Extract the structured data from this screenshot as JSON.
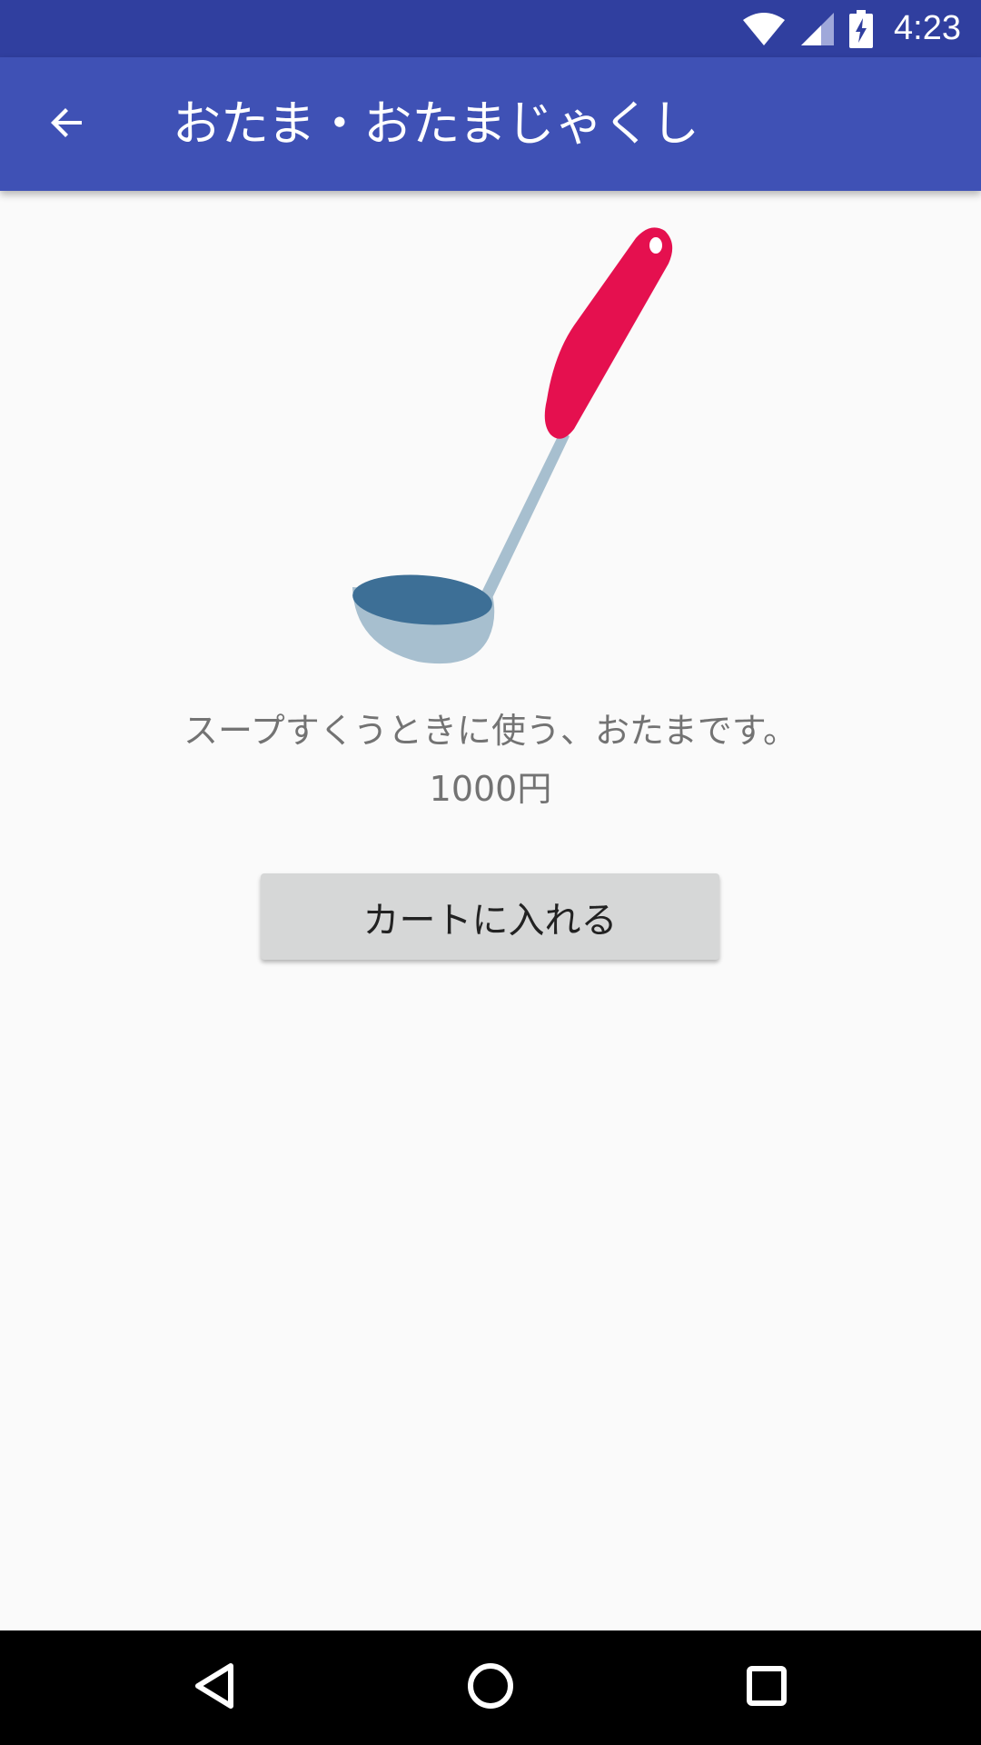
{
  "status_bar": {
    "time": "4:23",
    "icons": [
      "wifi-icon",
      "cell-signal-icon",
      "battery-charging-icon"
    ]
  },
  "app_bar": {
    "back_icon": "arrow-back-icon",
    "title": "おたま・おたまじゃくし",
    "color": "#3f51b5"
  },
  "product": {
    "image_icon": "ladle-illustration",
    "description": "スープすくうときに使う、おたまです。",
    "price": "1000円"
  },
  "actions": {
    "add_to_cart_label": "カートに入れる"
  },
  "nav_bar": {
    "icons": [
      "back-triangle-icon",
      "home-circle-icon",
      "recents-square-icon"
    ]
  },
  "colors": {
    "status_bar": "#303f9f",
    "app_bar": "#3f51b5",
    "background": "#fafafa",
    "button": "#d6d7d7",
    "ladle_handle": "#e5104f",
    "ladle_metal": "#a7bfcf",
    "ladle_bowl": "#3d6f96"
  }
}
